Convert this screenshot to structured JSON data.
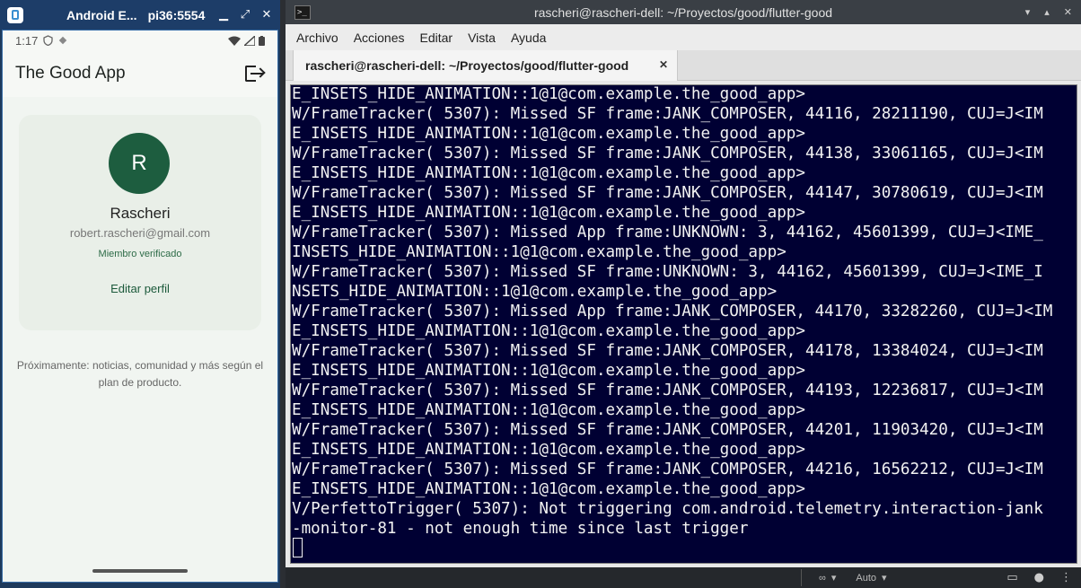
{
  "emulator": {
    "title": "Android E...",
    "subtitle": "pi36:5554",
    "controls": {
      "minimize": "▁",
      "restore": "⤢",
      "close": "✕"
    }
  },
  "phone": {
    "status_time": "1:17",
    "status_icons": [
      "shield-icon",
      "diamond-icon"
    ],
    "app_title": "The Good App",
    "logout_icon": "logout-icon",
    "profile": {
      "initial": "R",
      "name": "Rascheri",
      "email": "robert.rascheri@gmail.com",
      "verified": "Miembro verificado",
      "edit_label": "Editar perfil"
    },
    "coming_soon": "Próximamente: noticias, comunidad y más según el plan de producto.",
    "colors": {
      "avatar": "#1d5d3f",
      "accent": "#2d6b47",
      "background": "#f1f5f1"
    }
  },
  "terminal": {
    "title": "rascheri@rascheri-dell: ~/Proyectos/good/flutter-good",
    "menu": [
      "Archivo",
      "Acciones",
      "Editar",
      "Vista",
      "Ayuda"
    ],
    "tab_label": "rascheri@rascheri-dell: ~/Proyectos/good/flutter-good",
    "lines": [
      "E_INSETS_HIDE_ANIMATION::1@1@com.example.the_good_app>",
      "W/FrameTracker( 5307): Missed SF frame:JANK_COMPOSER, 44116, 28211190, CUJ=J<IM",
      "E_INSETS_HIDE_ANIMATION::1@1@com.example.the_good_app>",
      "W/FrameTracker( 5307): Missed SF frame:JANK_COMPOSER, 44138, 33061165, CUJ=J<IM",
      "E_INSETS_HIDE_ANIMATION::1@1@com.example.the_good_app>",
      "W/FrameTracker( 5307): Missed SF frame:JANK_COMPOSER, 44147, 30780619, CUJ=J<IM",
      "E_INSETS_HIDE_ANIMATION::1@1@com.example.the_good_app>",
      "W/FrameTracker( 5307): Missed App frame:UNKNOWN: 3, 44162, 45601399, CUJ=J<IME_",
      "INSETS_HIDE_ANIMATION::1@1@com.example.the_good_app>",
      "W/FrameTracker( 5307): Missed SF frame:UNKNOWN: 3, 44162, 45601399, CUJ=J<IME_I",
      "NSETS_HIDE_ANIMATION::1@1@com.example.the_good_app>",
      "W/FrameTracker( 5307): Missed App frame:JANK_COMPOSER, 44170, 33282260, CUJ=J<IM",
      "E_INSETS_HIDE_ANIMATION::1@1@com.example.the_good_app>",
      "W/FrameTracker( 5307): Missed SF frame:JANK_COMPOSER, 44178, 13384024, CUJ=J<IM",
      "E_INSETS_HIDE_ANIMATION::1@1@com.example.the_good_app>",
      "W/FrameTracker( 5307): Missed SF frame:JANK_COMPOSER, 44193, 12236817, CUJ=J<IM",
      "E_INSETS_HIDE_ANIMATION::1@1@com.example.the_good_app>",
      "W/FrameTracker( 5307): Missed SF frame:JANK_COMPOSER, 44201, 11903420, CUJ=J<IM",
      "E_INSETS_HIDE_ANIMATION::1@1@com.example.the_good_app>",
      "W/FrameTracker( 5307): Missed SF frame:JANK_COMPOSER, 44216, 16562212, CUJ=J<IM",
      "E_INSETS_HIDE_ANIMATION::1@1@com.example.the_good_app>",
      "V/PerfettoTrigger( 5307): Not triggering com.android.telemetry.interaction-jank",
      "-monitor-81 - not enough time since last trigger"
    ],
    "colors": {
      "background": "#000033",
      "text": "#f2f2f2"
    }
  },
  "bottom_bar": {
    "mode_label": "Auto"
  }
}
